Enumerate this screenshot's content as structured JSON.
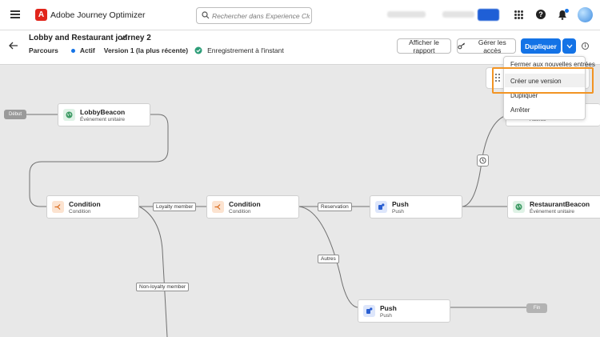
{
  "topbar": {
    "menu_icon": "hamburger-icon",
    "logo_letter": "A",
    "app_name": "Adobe Journey Optimizer",
    "search_placeholder": "Rechercher dans Experience Clo...",
    "icons": [
      "apps-icon",
      "help-icon",
      "bell-icon",
      "avatar"
    ]
  },
  "journey": {
    "title": "Lobby and Restaurant journey 2",
    "type_label": "Parcours",
    "status": "Actif",
    "version": "Version 1 (la plus récente)",
    "save_status": "Enregistrement à l'instant"
  },
  "actions": {
    "report": "Afficher le rapport",
    "access": "Gérer les accès",
    "duplicate": "Dupliquer"
  },
  "menu": {
    "items": [
      "Fermer aux nouvelles entrées",
      "Créer une version",
      "Dupliquer",
      "Arrêter"
    ],
    "highlighted": "Créer une version"
  },
  "canvas": {
    "start": "Début",
    "end": "Fin",
    "nodes": {
      "lobby": {
        "title": "LobbyBeacon",
        "subtitle": "Événement unitaire"
      },
      "condition1": {
        "title": "Condition",
        "subtitle": "Condition"
      },
      "condition2": {
        "title": "Condition",
        "subtitle": "Condition"
      },
      "push1": {
        "title": "Push",
        "subtitle": "Push"
      },
      "push2": {
        "title": "Push",
        "subtitle": "Push"
      },
      "restaurant": {
        "title": "RestaurantBeacon",
        "subtitle": "Événement unitaire"
      },
      "partial": {
        "subtitle": "Attente"
      }
    },
    "edges": {
      "loyalty": "Loyalty member",
      "non_loyalty": "Non-loyalty member",
      "reservation": "Reservation",
      "others": "Autres"
    }
  },
  "colors": {
    "accent": "#1473e6",
    "logo": "#e1251b",
    "highlight": "#f29423",
    "active_dot": "#1473e6",
    "check": "#2d9d78"
  }
}
